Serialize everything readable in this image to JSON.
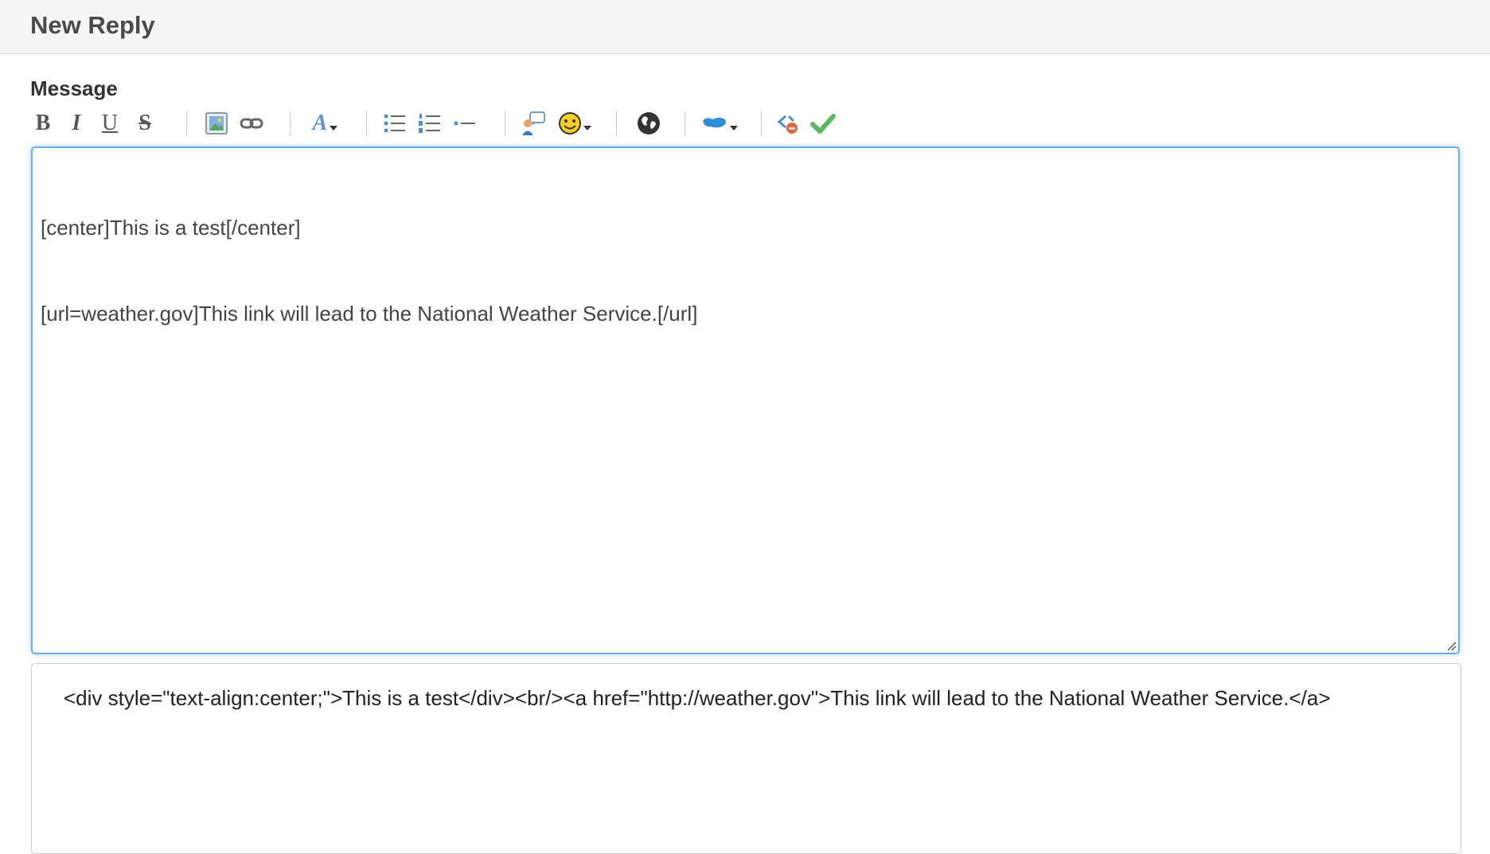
{
  "header": {
    "title": "New Reply"
  },
  "form": {
    "message_label": "Message"
  },
  "toolbar": {
    "bold": "B",
    "italic": "I",
    "underline": "U",
    "strike": "S",
    "font_letter": "A",
    "icons": [
      "bold-icon",
      "italic-icon",
      "underline-icon",
      "strikethrough-icon",
      "image-icon",
      "link-icon",
      "font-color-icon",
      "bullet-list-icon",
      "numbered-list-icon",
      "horizontal-rule-icon",
      "quote-icon",
      "smiley-icon",
      "globe-icon",
      "mascot-icon",
      "source-icon",
      "check-icon"
    ]
  },
  "editor": {
    "lines": [
      "[center]This is a test[/center]",
      "[url=weather.gov]This link will lead to the National Weather Service.[/url]"
    ]
  },
  "preview": {
    "html": "<div style=\"text-align:center;\">This is a test</div><br/><a href=\"http://weather.gov\">This link will lead to the National Weather Service.</a>"
  },
  "colors": {
    "focus_border": "#66aff0",
    "header_bg": "#f5f5f5",
    "check_green": "#5cb85c"
  }
}
